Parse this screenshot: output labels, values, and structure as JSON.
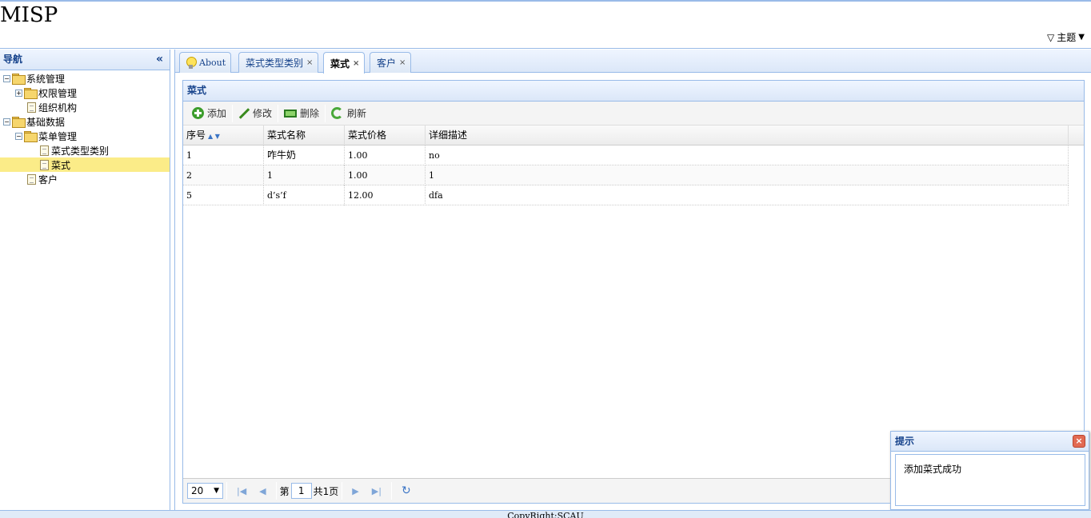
{
  "header": {
    "app_title": "MISP",
    "theme_label": "主题"
  },
  "west": {
    "title": "导航",
    "tree": [
      {
        "label": "系统管理",
        "level": 0,
        "type": "folder",
        "toggle": "⊟"
      },
      {
        "label": "权限管理",
        "level": 1,
        "type": "folder",
        "toggle": "⊞"
      },
      {
        "label": "组织机构",
        "level": 1,
        "type": "file"
      },
      {
        "label": "基础数据",
        "level": 0,
        "type": "folder",
        "toggle": "⊟"
      },
      {
        "label": "菜单管理",
        "level": 1,
        "type": "folder",
        "toggle": "⊟"
      },
      {
        "label": "菜式类型类别",
        "level": 2,
        "type": "file"
      },
      {
        "label": "菜式",
        "level": 2,
        "type": "file",
        "selected": true
      },
      {
        "label": "客户",
        "level": 1,
        "type": "file"
      }
    ]
  },
  "tabs": [
    {
      "label": "About",
      "closable": false
    },
    {
      "label": "菜式类型类别",
      "closable": true
    },
    {
      "label": "菜式",
      "closable": true,
      "active": true
    },
    {
      "label": "客户",
      "closable": true
    }
  ],
  "panel": {
    "title": "菜式"
  },
  "toolbar": {
    "add": "添加",
    "edit": "修改",
    "delete": "删除",
    "refresh": "刷新"
  },
  "grid": {
    "columns": [
      "序号",
      "菜式名称",
      "菜式价格",
      "详细描述"
    ],
    "rows": [
      [
        "1",
        "咋牛奶",
        "1.00",
        "no"
      ],
      [
        "2",
        "1",
        "1.00",
        "1"
      ],
      [
        "5",
        "d’s’f",
        "12.00",
        "dfa"
      ]
    ]
  },
  "pager": {
    "page_size": "20",
    "page_prefix": "第",
    "page_number": "1",
    "page_total": "共1页"
  },
  "message": {
    "title": "提示",
    "text": "添加菜式成功"
  },
  "footer": {
    "text": "CopyRight:SCAU"
  }
}
